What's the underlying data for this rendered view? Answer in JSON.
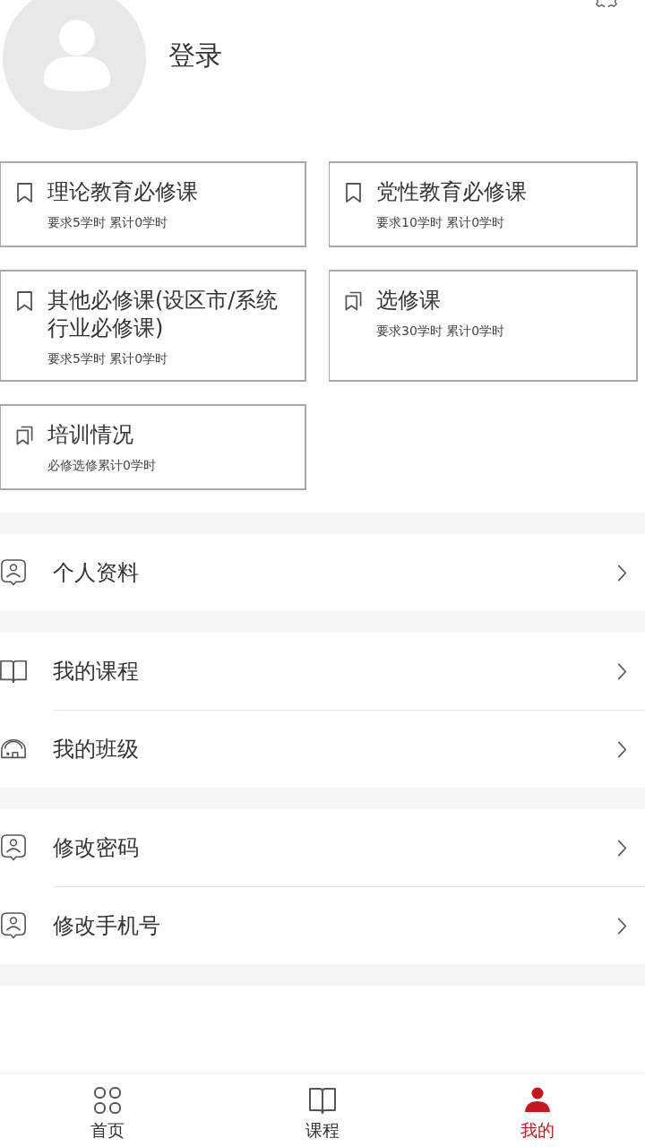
{
  "header": {
    "login_label": "登录"
  },
  "cards": [
    {
      "kind": "single",
      "title": "理论教育必修课",
      "detail": "要求5学时 累计0学时"
    },
    {
      "kind": "single",
      "title": "党性教育必修课",
      "detail": "要求10学时 累计0学时"
    },
    {
      "kind": "single",
      "title": "其他必修课(设区市/系统行业必修课)",
      "detail": "要求5学时 累计0学时"
    },
    {
      "kind": "double",
      "title": "选修课",
      "detail": "要求30学时 累计0学时"
    },
    {
      "kind": "double",
      "title": "培训情况",
      "detail": "必修选修累计0学时"
    }
  ],
  "menu_groups": [
    {
      "items": [
        {
          "kind": "person",
          "label": "个人资料"
        }
      ]
    },
    {
      "items": [
        {
          "kind": "book",
          "label": "我的课程"
        },
        {
          "kind": "house",
          "label": "我的班级"
        }
      ]
    },
    {
      "items": [
        {
          "kind": "person",
          "label": "修改密码"
        },
        {
          "kind": "person",
          "label": "修改手机号"
        }
      ]
    }
  ],
  "tab_bar": [
    {
      "kind": "grid",
      "label": "首页",
      "selected": false
    },
    {
      "kind": "book",
      "label": "课程",
      "selected": false
    },
    {
      "kind": "person",
      "label": "我的",
      "selected": true
    }
  ]
}
